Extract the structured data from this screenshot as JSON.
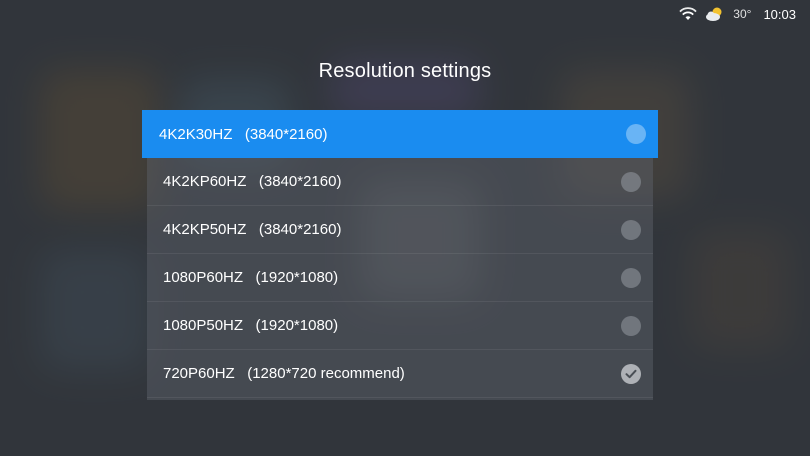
{
  "status_bar": {
    "wifi_icon": "wifi-icon",
    "weather_icon": "partly-cloudy-icon",
    "temperature": "30°",
    "time": "10:03"
  },
  "dialog": {
    "title": "Resolution settings",
    "options": [
      {
        "label": "4K2K30HZ   (3840*2160)",
        "state": "focused"
      },
      {
        "label": "4K2KP60HZ   (3840*2160)",
        "state": "unchecked"
      },
      {
        "label": "4K2KP50HZ   (3840*2160)",
        "state": "unchecked"
      },
      {
        "label": "1080P60HZ   (1920*1080)",
        "state": "unchecked"
      },
      {
        "label": "1080P50HZ   (1920*1080)",
        "state": "unchecked"
      },
      {
        "label": "720P60HZ   (1280*720 recommend)",
        "state": "checked"
      }
    ]
  },
  "colors": {
    "focus_accent": "#1a8cf0",
    "text": "#ffffff"
  }
}
